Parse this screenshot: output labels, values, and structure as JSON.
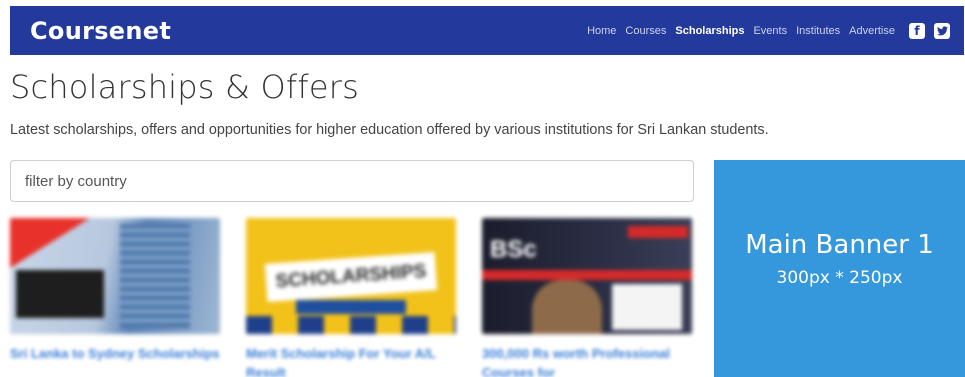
{
  "navbar": {
    "brand": "Coursenet",
    "links": [
      {
        "label": "Home",
        "active": false
      },
      {
        "label": "Courses",
        "active": false
      },
      {
        "label": "Scholarships",
        "active": true
      },
      {
        "label": "Events",
        "active": false
      },
      {
        "label": "Institutes",
        "active": false
      },
      {
        "label": "Advertise",
        "active": false
      }
    ],
    "social_icons": [
      "facebook-icon",
      "twitter-icon"
    ],
    "background_color": "#23399b"
  },
  "page": {
    "title": "Scholarships & Offers",
    "description": "Latest scholarships, offers and opportunities for higher education offered by various institutions for Sri Lankan students."
  },
  "filter": {
    "placeholder": "filter by country",
    "value": ""
  },
  "cards": [
    {
      "title": "Sri Lanka to Sydney Scholarships"
    },
    {
      "title": "Merit Scholarship For Your A/L Result",
      "image_text": "SCHOLARSHIPS"
    },
    {
      "title": "300,000 Rs worth Professional Courses for",
      "image_text": "BSc"
    }
  ],
  "ad_banner": {
    "title": "Main Banner 1",
    "size_label": "300px * 250px",
    "background_color": "#3598dc"
  },
  "colors": {
    "link": "#3b7fd8",
    "accent": "#23399b"
  }
}
